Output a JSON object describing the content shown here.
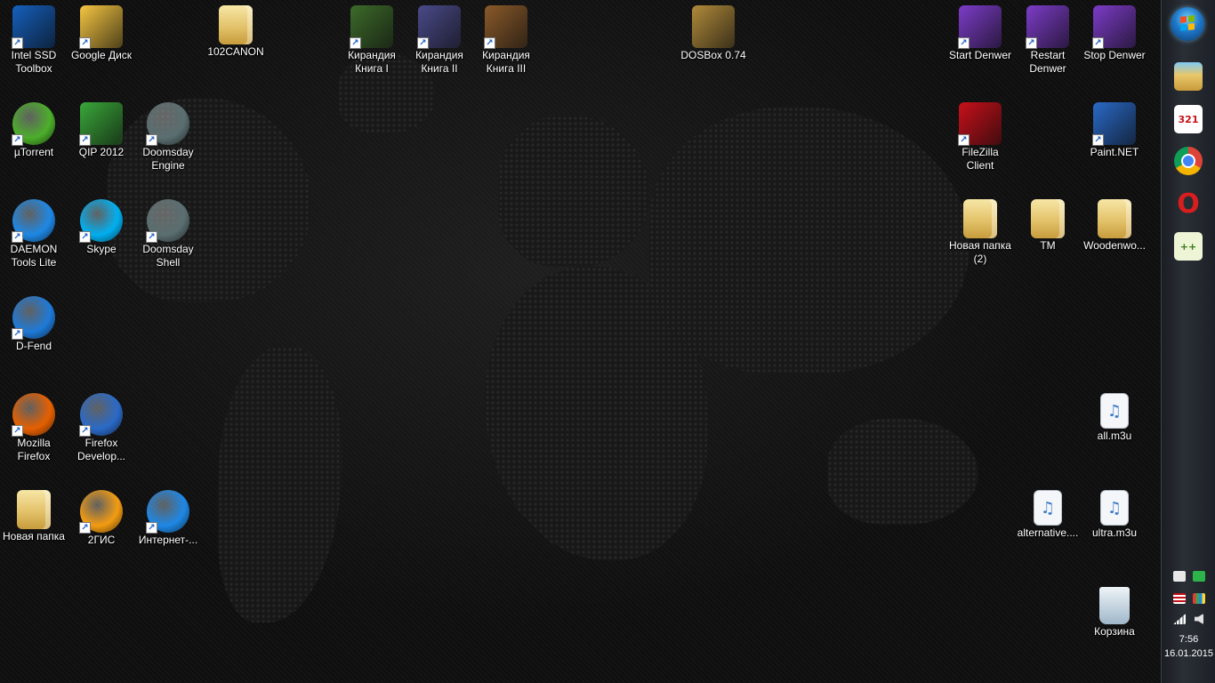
{
  "desktop": {
    "icons": [
      {
        "label": "Intel SSD\nToolbox",
        "icon": "intel-ssd-icon",
        "shortcut": true,
        "color": "#1560bd"
      },
      {
        "label": "Google Диск",
        "icon": "google-drive-icon",
        "shortcut": true,
        "color": "#f6c642"
      },
      {
        "label": "102CANON",
        "icon": "folder-icon",
        "shortcut": false,
        "color": "#e3c26a"
      },
      {
        "label": "Кирандия\nКнига I",
        "icon": "kyrandia-1-icon",
        "shortcut": true,
        "color": "#3d6b2a"
      },
      {
        "label": "Кирандия\nКнига II",
        "icon": "kyrandia-2-icon",
        "shortcut": true,
        "color": "#4a4a8a"
      },
      {
        "label": "Кирандия\nКнига III",
        "icon": "kyrandia-3-icon",
        "shortcut": true,
        "color": "#8a5a2a"
      },
      {
        "label": "DOSBox 0.74",
        "icon": "dosbox-icon",
        "shortcut": false,
        "color": "#b08a3a"
      },
      {
        "label": "Start Denwer",
        "icon": "denwer-start-icon",
        "shortcut": true,
        "color": "#7c3cc8"
      },
      {
        "label": "Restart\nDenwer",
        "icon": "denwer-restart-icon",
        "shortcut": true,
        "color": "#7c3cc8"
      },
      {
        "label": "Stop Denwer",
        "icon": "denwer-stop-icon",
        "shortcut": true,
        "color": "#7c3cc8"
      },
      {
        "label": "µTorrent",
        "icon": "utorrent-icon",
        "shortcut": true,
        "color": "#4caf2a"
      },
      {
        "label": "QIP 2012",
        "icon": "qip-icon",
        "shortcut": true,
        "color": "#3aa83a"
      },
      {
        "label": "Doomsday\nEngine",
        "icon": "doomsday-engine-icon",
        "shortcut": true,
        "color": "#5a6e70"
      },
      {
        "label": "FileZilla\nClient",
        "icon": "filezilla-icon",
        "shortcut": true,
        "color": "#c8101a"
      },
      {
        "label": "Paint.NET",
        "icon": "paintnet-icon",
        "shortcut": true,
        "color": "#2a6ac8"
      },
      {
        "label": "DAEMON\nTools Lite",
        "icon": "daemon-tools-icon",
        "shortcut": true,
        "color": "#1e88e5"
      },
      {
        "label": "Skype",
        "icon": "skype-icon",
        "shortcut": true,
        "color": "#00aff0"
      },
      {
        "label": "Doomsday\nShell",
        "icon": "doomsday-shell-icon",
        "shortcut": true,
        "color": "#5a6e70"
      },
      {
        "label": "Новая папка\n(2)",
        "icon": "folder-icon",
        "shortcut": false,
        "color": "#e3c26a"
      },
      {
        "label": "TM",
        "icon": "folder-icon",
        "shortcut": false,
        "color": "#e3c26a"
      },
      {
        "label": "Woodenwo...",
        "icon": "folder-icon",
        "shortcut": false,
        "color": "#e3c26a"
      },
      {
        "label": "D-Fend",
        "icon": "dfend-icon",
        "shortcut": true,
        "color": "#1e7ad8"
      },
      {
        "label": "Mozilla\nFirefox",
        "icon": "firefox-icon",
        "shortcut": true,
        "color": "#e66000"
      },
      {
        "label": "Firefox\nDevelop...",
        "icon": "firefox-developer-icon",
        "shortcut": true,
        "color": "#2a6ac8"
      },
      {
        "label": "all.m3u",
        "icon": "playlist-file-icon",
        "shortcut": false,
        "color": "#3a7ac8"
      },
      {
        "label": "Новая папка",
        "icon": "folder-icon",
        "shortcut": false,
        "color": "#e3c26a"
      },
      {
        "label": "2ГИС",
        "icon": "2gis-icon",
        "shortcut": true,
        "color": "#f39c12"
      },
      {
        "label": "Интернет-...",
        "icon": "internet-icon",
        "shortcut": true,
        "color": "#1e88e5"
      },
      {
        "label": "alternative....",
        "icon": "playlist-file-icon",
        "shortcut": false,
        "color": "#3a7ac8"
      },
      {
        "label": "ultra.m3u",
        "icon": "playlist-file-icon",
        "shortcut": false,
        "color": "#3a7ac8"
      },
      {
        "label": "Корзина",
        "icon": "recycle-bin-icon",
        "shortcut": false,
        "color": "#9fb7c9"
      }
    ]
  },
  "taskbar": {
    "start_icon": "windows-start-icon",
    "pinned": [
      {
        "icon": "explorer-icon",
        "text": "",
        "color": "#e8b84a"
      },
      {
        "icon": "media-player-classic-icon",
        "text": "321",
        "color": "#ffffff"
      },
      {
        "icon": "chrome-icon",
        "text": "",
        "color": "#2e9a45"
      },
      {
        "icon": "opera-icon",
        "text": "O",
        "color": "#d81e1e"
      },
      {
        "icon": "notepad-plus-plus-icon",
        "text": "++",
        "color": "#8bc34a"
      }
    ],
    "tray": {
      "icons": [
        "usb-device-icon",
        "check-icon",
        "language-flag-icon",
        "color-bars-icon",
        "network-signal-icon",
        "volume-icon"
      ],
      "time": "7:56",
      "date": "16.01.2015"
    }
  }
}
